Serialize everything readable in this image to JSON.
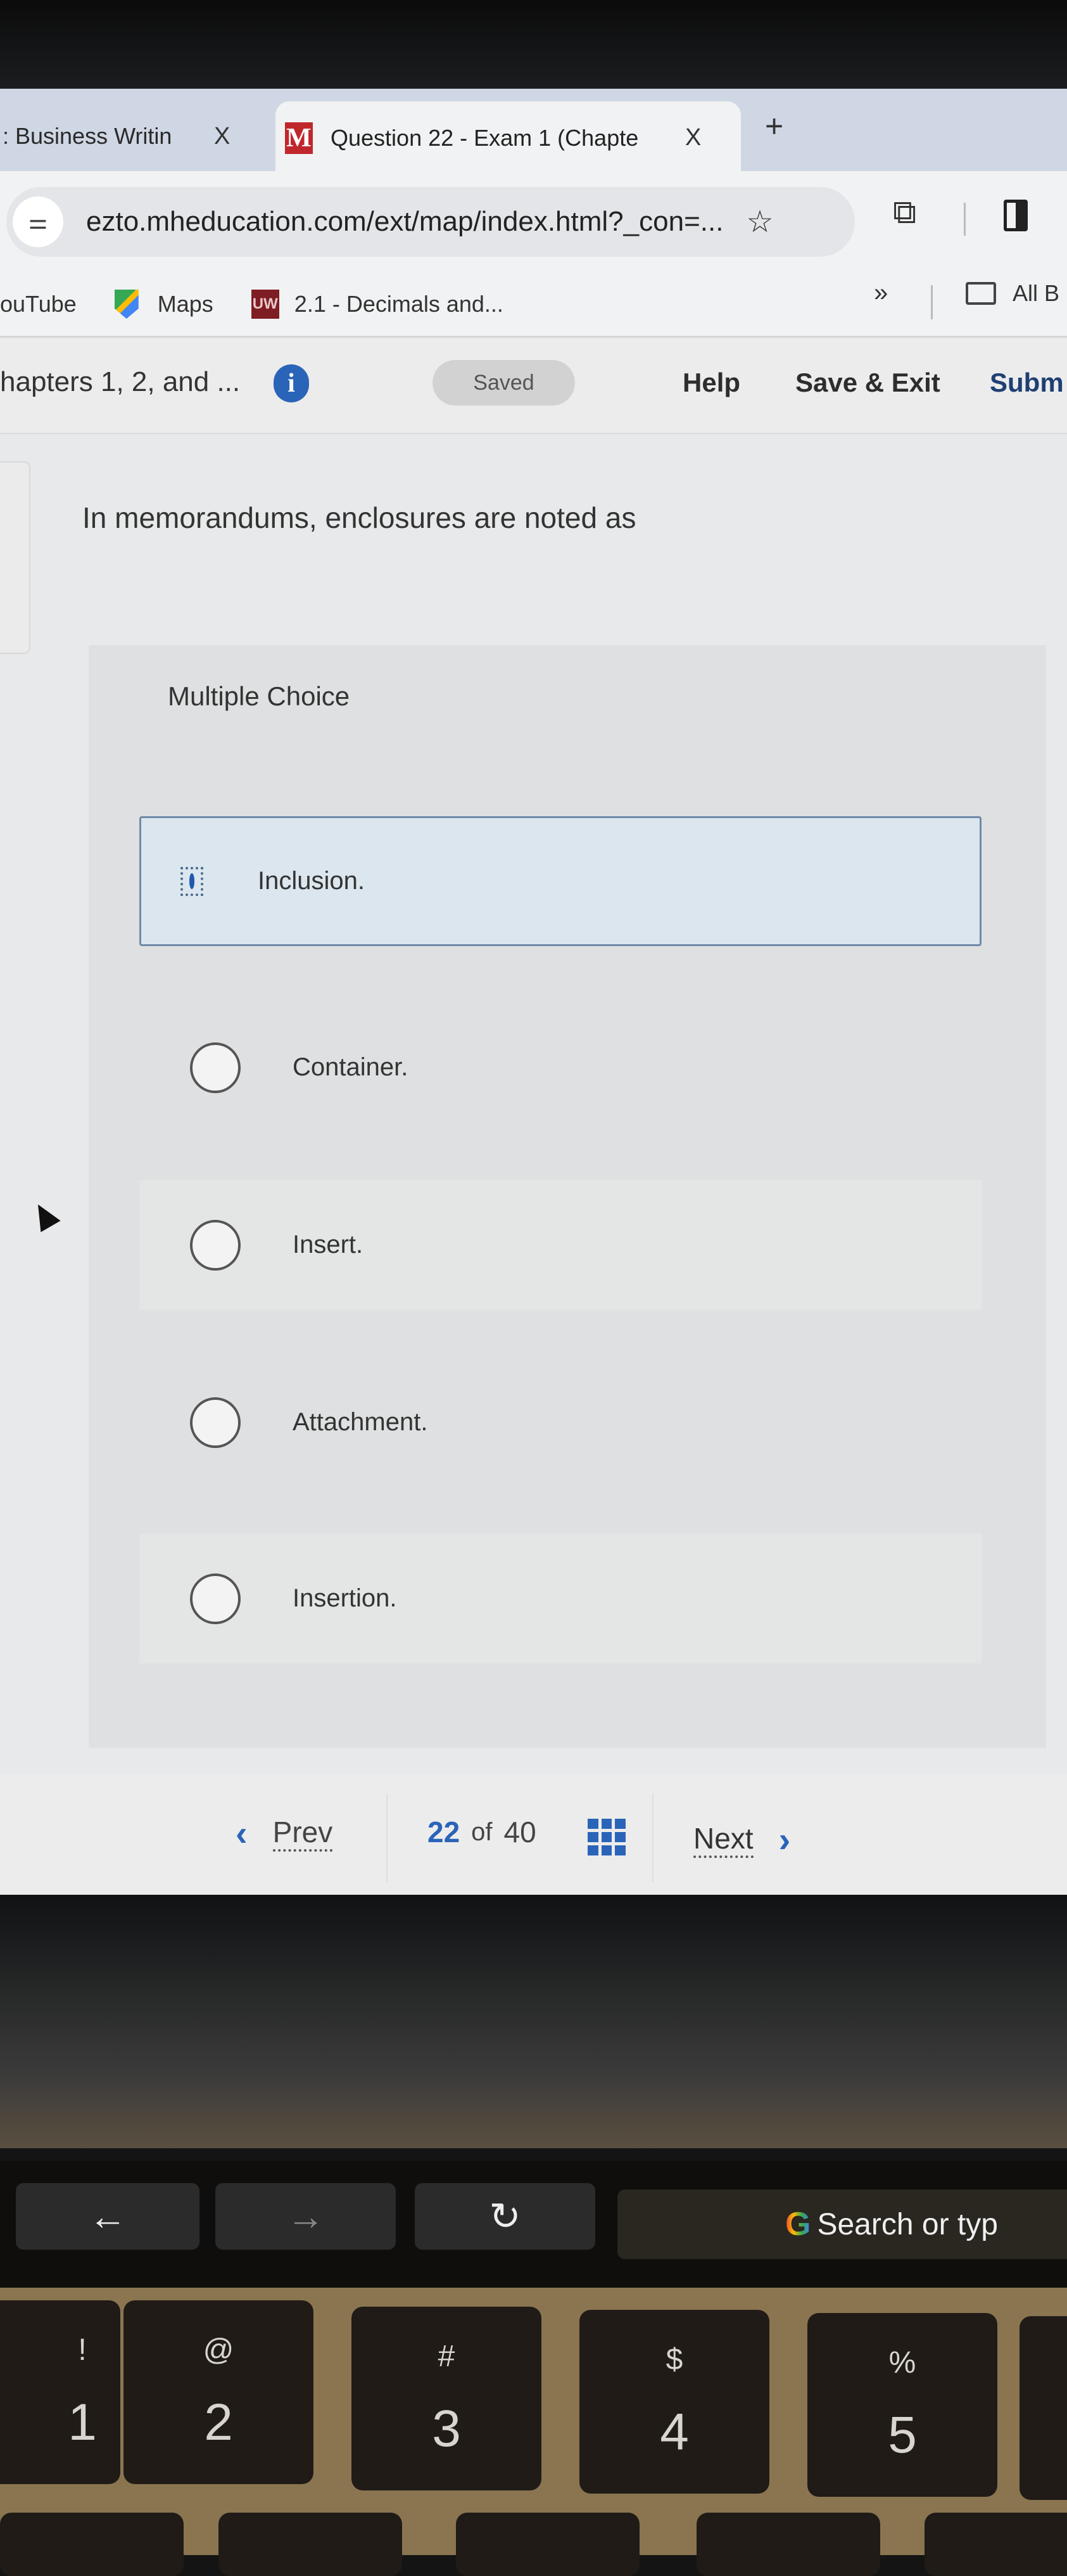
{
  "browser": {
    "tabs": [
      {
        "title": ": Business Writin",
        "active": false,
        "close_label": "X"
      },
      {
        "title": "Question 22 - Exam 1 (Chapte",
        "active": true,
        "favicon": "M",
        "close_label": "X"
      }
    ],
    "new_tab_label": "+",
    "address_bar": {
      "site_icon": "tune-icon",
      "url": "ezto.mheducation.com/ext/map/index.html?_con=...",
      "bookmark_icon": "star-icon"
    },
    "toolbar_icons": [
      "extensions-icon",
      "side-panel-icon"
    ],
    "bookmarks": [
      {
        "label": "ouTube",
        "icon": "youtube-icon"
      },
      {
        "label": "Maps",
        "icon": "maps-icon"
      },
      {
        "label": "2.1 - Decimals and...",
        "icon": "uw-icon",
        "icon_text": "UW"
      }
    ],
    "bookmarks_more_label": "»",
    "all_bookmarks_label": "All B"
  },
  "app_header": {
    "breadcrumb": "hapters 1, 2, and ...",
    "info_icon_label": "i",
    "saved_badge": "Saved",
    "help": "Help",
    "save_exit": "Save & Exit",
    "submit": "Subm"
  },
  "question": {
    "prompt": "In memorandums, enclosures are noted as",
    "type_label": "Multiple Choice",
    "options": [
      {
        "label": "Inclusion.",
        "selected": true
      },
      {
        "label": "Container.",
        "selected": false
      },
      {
        "label": "Insert.",
        "selected": false
      },
      {
        "label": "Attachment.",
        "selected": false
      },
      {
        "label": "Insertion.",
        "selected": false
      }
    ]
  },
  "navigation": {
    "prev_label": "Prev",
    "current_page": "22",
    "of_label": "of",
    "total_pages": "40",
    "next_label": "Next",
    "prev_chevron": "‹",
    "next_chevron": "›"
  },
  "touch_bar": {
    "back": "←",
    "forward": "→",
    "reload": "↻",
    "search_g": "G",
    "search_placeholder": "Search or typ"
  },
  "keyboard": {
    "keys": [
      {
        "sym": "!",
        "num": "1"
      },
      {
        "sym": "@",
        "num": "2"
      },
      {
        "sym": "#",
        "num": "3"
      },
      {
        "sym": "$",
        "num": "4"
      },
      {
        "sym": "%",
        "num": "5"
      }
    ]
  },
  "colors": {
    "accent_blue": "#2a64b8",
    "submit_blue": "#1f3f73",
    "favicon_red": "#c0272d",
    "selected_option_bg": "#dbe6ee"
  }
}
